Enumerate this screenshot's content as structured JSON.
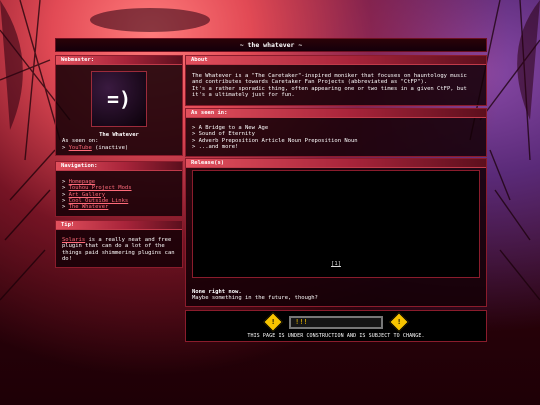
{
  "site": {
    "title": "~ the whatever ~"
  },
  "webmaster": {
    "header": "Webmaster:",
    "avatar_text": "=)",
    "name": "The Whatever",
    "as_seen_label": "As seen on:",
    "youtube_prefix": "> ",
    "youtube_link": "YouTube",
    "youtube_suffix": " (inactive)"
  },
  "navigation": {
    "header": "Navigation:",
    "items": [
      {
        "prefix": "> ",
        "label": "Homepage"
      },
      {
        "prefix": "> ",
        "label": "Touhou Project Mods"
      },
      {
        "prefix": "> ",
        "label": "Art Gallery"
      },
      {
        "prefix": "> ",
        "label": "Cool Outside Links"
      },
      {
        "prefix": "> ",
        "label": "The Whatever"
      }
    ]
  },
  "tip": {
    "header": "Tip!",
    "link": "Solaris",
    "text": " is a really neat and free plugin that can do a lot of the things paid shimmering plugins can do!"
  },
  "about": {
    "header": "About",
    "line1": "The Whatever is a \"The Caretaker\"-inspired moniker that focuses on hauntology music and contributes towards Caretaker Fan Projects (abbreviated as \"CtFP\").",
    "line2": "It's a rather sporadic thing, often appearing one or two times in a given CtFP, but it's a ultimately just for fun."
  },
  "seen_in": {
    "header": "As seen in:",
    "items": [
      "> A Bridge to a New Age",
      "> Sound of Eternity",
      "> Adverb Preposition Article Noun Preposition Noun",
      "> ...and more!"
    ]
  },
  "releases": {
    "header": "Release(s)",
    "page_indicator": "[1]",
    "none_text": "None right now.",
    "maybe_text": "Maybe something in the future, though?"
  },
  "footer": {
    "barrier_text": "!!!",
    "warning_glyph": "!",
    "construction_text": "THIS PAGE IS UNDER CONSTRUCTION AND IS SUBJECT TO CHANGE."
  },
  "colors": {
    "accent": "#e2505d",
    "link": "#ff6b7a",
    "panel_border": "#8a1c2c",
    "warning": "#f7c400"
  }
}
